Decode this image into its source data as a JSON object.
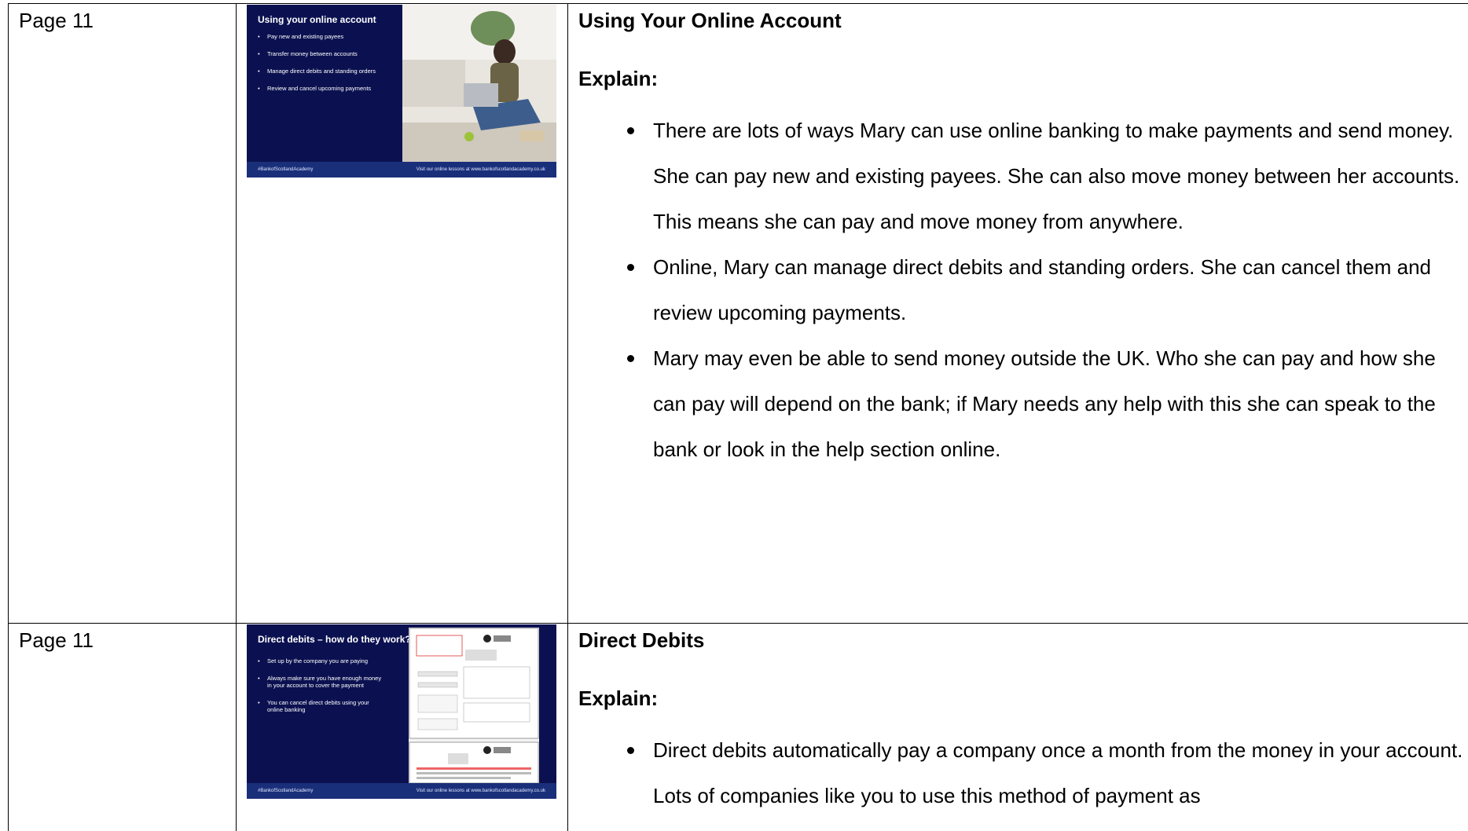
{
  "rows": [
    {
      "page": "Page 11",
      "slide": {
        "title": "Using your online account",
        "bullets": [
          "Pay new and existing payees",
          "Transfer money between accounts",
          "Manage direct debits and standing orders",
          "Review and cancel upcoming payments"
        ],
        "footer_left": "#BankofScotlandAcademy",
        "footer_right": "Visit our online lessons at www.bankofscotlandacademy.co.uk"
      },
      "heading": "Using Your Online Account",
      "explain": "Explain:",
      "points": [
        "There are lots of ways Mary can use online banking to make payments and send money. She can pay new and existing payees. She can also move money between her accounts. This means she can pay and move money from anywhere.",
        "Online, Mary can manage direct debits and standing orders. She can cancel them and review upcoming payments.",
        "Mary may even be able to send money outside the UK. Who she can pay and how she can pay will depend on the bank; if Mary needs any help with this she can speak to the bank or look in the help section online."
      ]
    },
    {
      "page": "Page 11",
      "slide": {
        "title": "Direct debits – how do they work?",
        "bullets": [
          "Set up by the company you are paying",
          "Always make sure you have enough money in your account to cover the payment",
          "You can cancel direct debits using your online banking"
        ],
        "footer_left": "#BankofScotlandAcademy",
        "footer_right": "Visit our online lessons at www.bankofscotlandacademy.co.uk"
      },
      "heading": "Direct Debits",
      "explain": "Explain:",
      "points": [
        "Direct debits automatically pay a company once a month from the money in your account. Lots of companies like you to use this method of payment as"
      ]
    }
  ]
}
